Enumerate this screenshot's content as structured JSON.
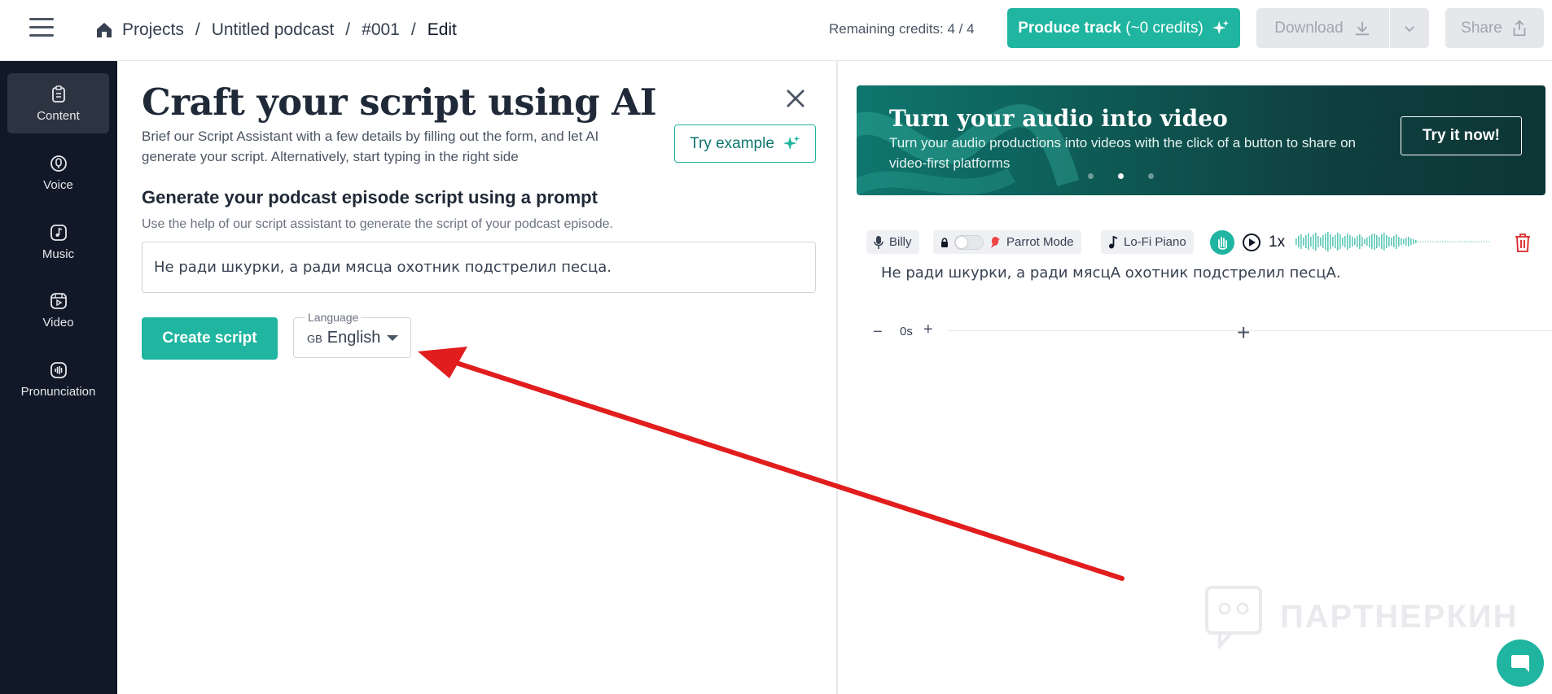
{
  "header": {
    "breadcrumb": [
      "Projects",
      "Untitled podcast",
      "#001",
      "Edit"
    ],
    "separator": "/",
    "credits": "Remaining credits: 4 / 4",
    "produce_label": "Produce track",
    "produce_sub": "(~0 credits)",
    "download_label": "Download",
    "share_label": "Share"
  },
  "sidebar": {
    "items": [
      {
        "label": "Content",
        "icon": "content-icon",
        "active": true
      },
      {
        "label": "Voice",
        "icon": "voice-icon"
      },
      {
        "label": "Music",
        "icon": "music-icon"
      },
      {
        "label": "Video",
        "icon": "video-icon"
      },
      {
        "label": "Pronunciation",
        "icon": "pronunciation-icon"
      }
    ]
  },
  "assistant": {
    "title": "Craft your script using AI",
    "description": "Brief our Script Assistant with a few details by filling out the form, and let AI generate your script. Alternatively, start typing in the right side",
    "try_example": "Try example",
    "section_heading": "Generate your podcast episode script using a prompt",
    "section_sub": "Use the help of our script assistant to generate the script of your podcast episode.",
    "prompt_value": "Не ради шкурки, а ради мясца охотник подстрелил песца.",
    "create_button": "Create script",
    "language_label": "Language",
    "language_flag": "GB",
    "language_value": "English"
  },
  "banner": {
    "title": "Turn your audio into video",
    "text": "Turn your audio productions into videos with the click of a button to share on video-first platforms",
    "button": "Try it now!",
    "active_slide": 2,
    "slides": 3
  },
  "track": {
    "voice": "Billy",
    "mode": "Parrot Mode",
    "music": "Lo-Fi Piano",
    "speed": "1x",
    "text": "Не ради шкурки, а ради мясцА охотник подстрелил песцА."
  },
  "pause": {
    "minus": "−",
    "value": "0s",
    "plus": "+",
    "add": "+"
  },
  "watermark": "ПАРТНЕРКИН",
  "colors": {
    "accent": "#1fb5a0",
    "sidebar_bg": "#111827",
    "annotation_arrow": "#e11d1d"
  }
}
